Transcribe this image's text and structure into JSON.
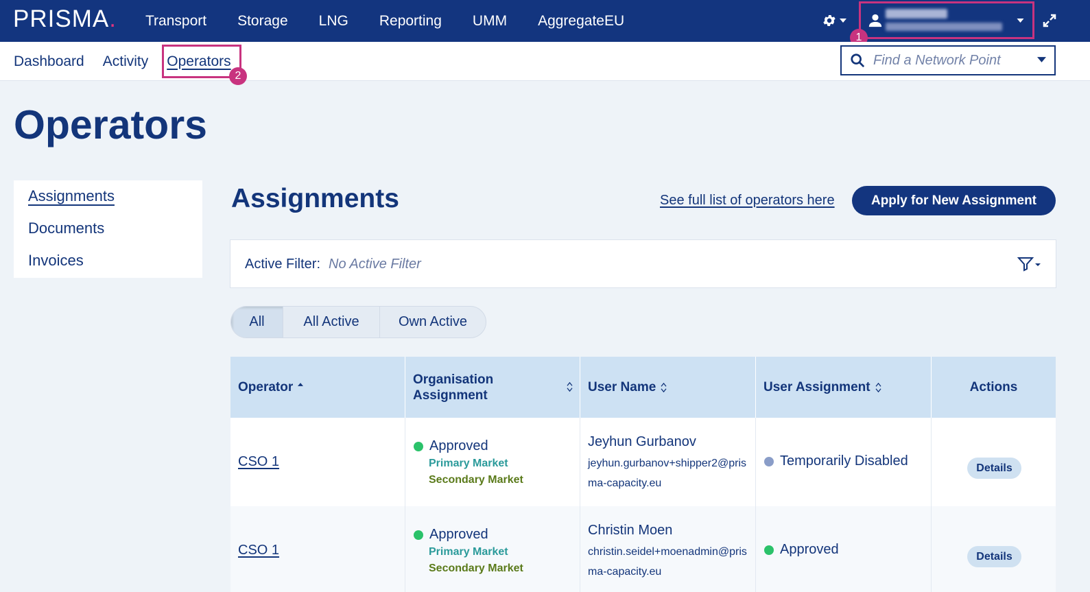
{
  "app": {
    "logo": "PRISMA",
    "logo_dot": "."
  },
  "topnav": [
    "Transport",
    "Storage",
    "LNG",
    "Reporting",
    "UMM",
    "AggregateEU"
  ],
  "annotations": {
    "badge1": "1",
    "badge2": "2"
  },
  "subnav": [
    "Dashboard",
    "Activity",
    "Operators"
  ],
  "network_search": {
    "placeholder": "Find a Network Point"
  },
  "page_title": "Operators",
  "sidemenu": [
    "Assignments",
    "Documents",
    "Invoices"
  ],
  "section": {
    "title": "Assignments",
    "full_list_link": "See full list of operators here",
    "apply_button": "Apply for New Assignment"
  },
  "filter": {
    "label": "Active Filter:",
    "value": "No Active Filter"
  },
  "segments": [
    "All",
    "All Active",
    "Own Active"
  ],
  "table": {
    "headers": [
      "Operator",
      "Organisation Assignment",
      "User Name",
      "User Assignment",
      "Actions"
    ],
    "rows": [
      {
        "operator": "CSO 1",
        "org_status": "Approved",
        "market1": "Primary Market",
        "market2": "Secondary Market",
        "user_name": "Jeyhun Gurbanov",
        "user_email": "jeyhun.gurbanov+shipper2@prisma-capacity.eu",
        "user_assignment": "Temporarily Disabled",
        "action": "Details"
      },
      {
        "operator": "CSO 1",
        "org_status": "Approved",
        "market1": "Primary Market",
        "market2": "Secondary Market",
        "user_name": "Christin Moen",
        "user_email": "christin.seidel+moenadmin@prisma-capacity.eu",
        "user_assignment": "Approved",
        "action": "Details"
      }
    ]
  },
  "colors": {
    "primary": "#13357f",
    "highlight": "#c8337f",
    "approved": "#2bc26a",
    "disabled": "#8a9dc8"
  }
}
